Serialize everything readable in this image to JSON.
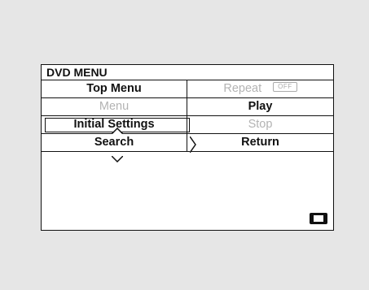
{
  "menu": {
    "title": "DVD MENU",
    "rows": [
      {
        "left": "Top Menu",
        "right": "Repeat",
        "right_badge": "OFF"
      },
      {
        "left": "Menu",
        "right": "Play"
      },
      {
        "left": "Initial Settings",
        "right": "Stop"
      },
      {
        "left": "Search",
        "right": "Return"
      }
    ],
    "selected": "Initial Settings",
    "disabled_items": [
      "Repeat",
      "Menu",
      "Stop"
    ]
  },
  "icons": {
    "up": "up-chevron-icon",
    "down": "down-chevron-icon",
    "right": "right-chevron-icon",
    "corner": "display-mode-icon"
  },
  "colors": {
    "background": "#e6e6e6",
    "panel": "#ffffff",
    "text": "#111111",
    "disabled": "#b3b3b3"
  }
}
